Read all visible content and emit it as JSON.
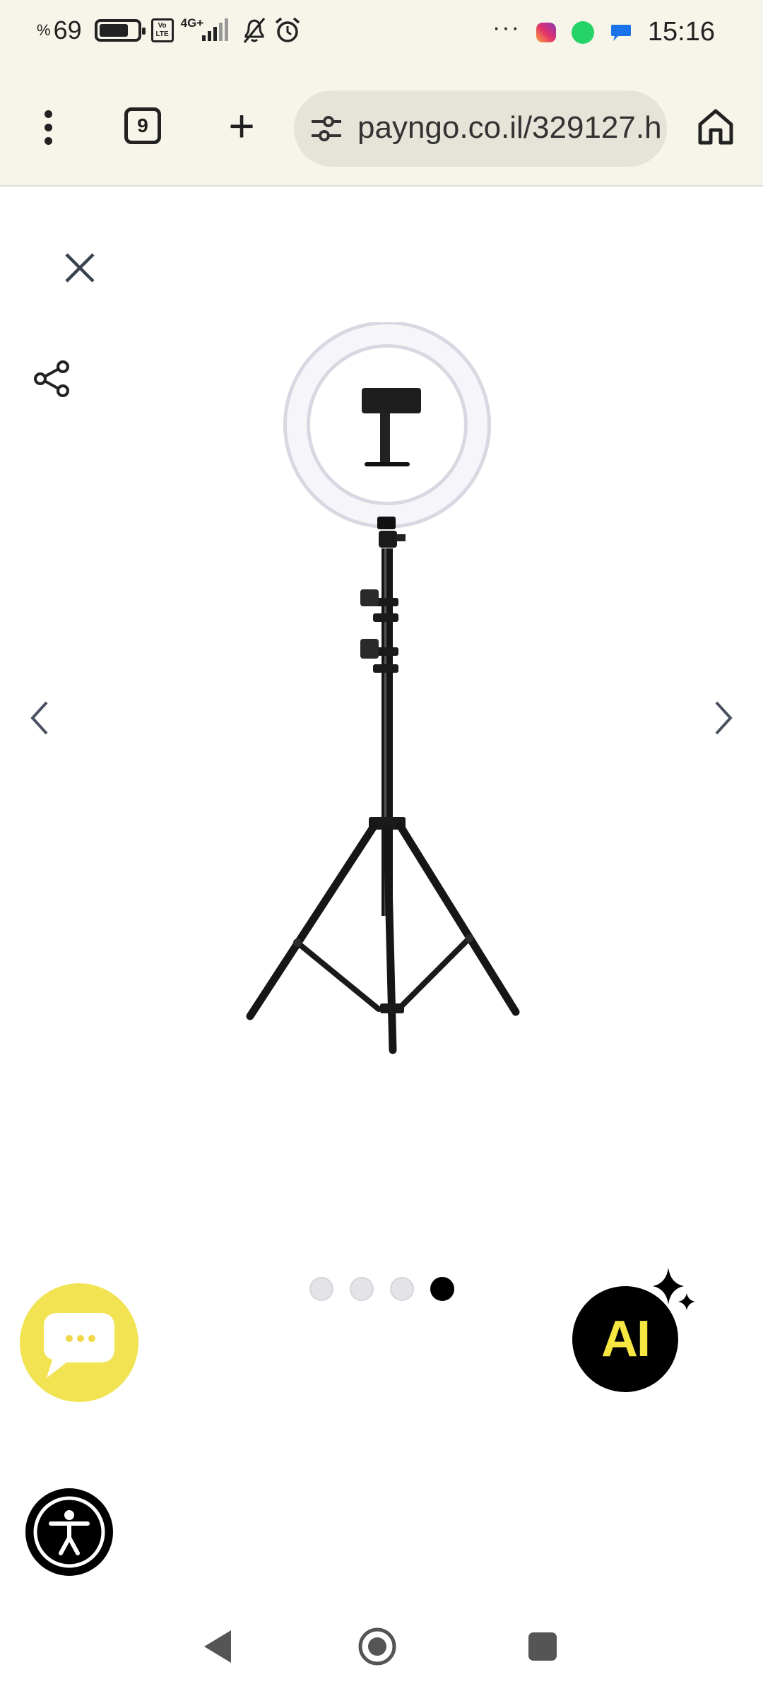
{
  "status_bar": {
    "battery_percent_symbol": "%",
    "battery_percent": "69",
    "battery_level": 0.69,
    "volte_label": "Vo LTE",
    "network_type": "4G+",
    "more_icons": "···",
    "time": "15:16",
    "icons": [
      "battery-icon",
      "volte-icon",
      "signal-icon",
      "mute-icon",
      "alarm-icon",
      "instagram-icon",
      "whatsapp-icon",
      "messages-icon"
    ]
  },
  "browser": {
    "tab_count": "9",
    "new_tab_label": "+",
    "url": "payngo.co.il/329127.h",
    "icons": [
      "menu-icon",
      "tabs-icon",
      "plus-icon",
      "site-settings-icon",
      "home-icon"
    ]
  },
  "gallery": {
    "total_images": 4,
    "current_index": 4,
    "icons": [
      "close-icon",
      "share-icon",
      "chevron-left-icon",
      "chevron-right-icon"
    ]
  },
  "floating": {
    "ai_label": "AI",
    "icons": [
      "chat-icon",
      "sparkle-icon",
      "accessibility-icon"
    ]
  },
  "colors": {
    "browser_chrome": "#f7f5ea",
    "url_pill": "#e6e4d8",
    "chat_fab": "#f1e352",
    "ai_text": "#f5e642",
    "pager_active": "#000000",
    "pager_inactive": "#e4e4e8"
  }
}
